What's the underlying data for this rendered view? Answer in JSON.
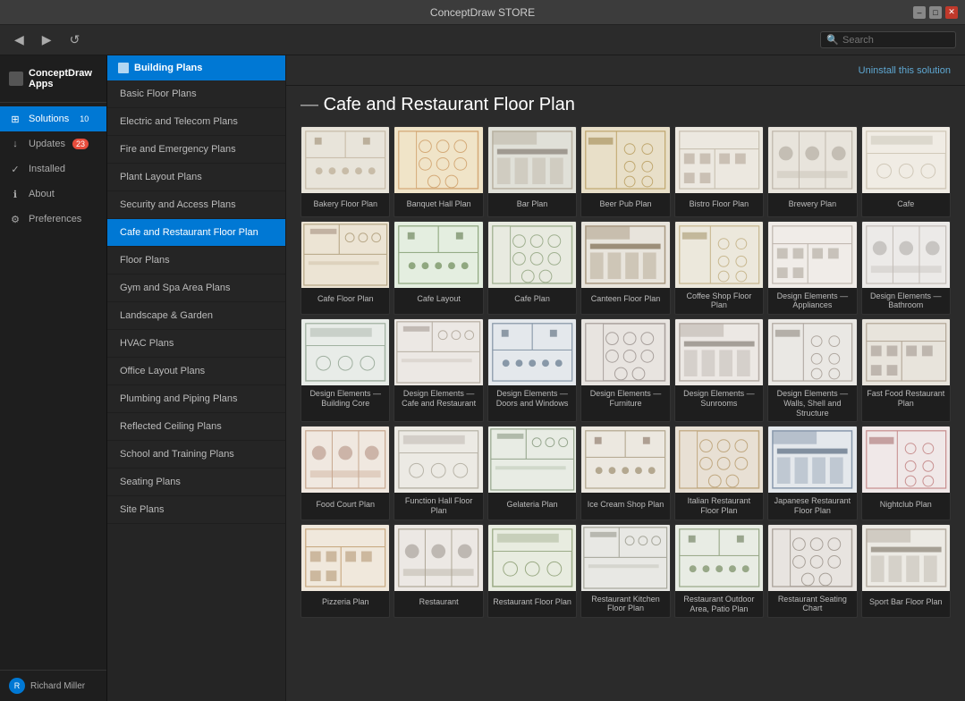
{
  "titlebar": {
    "title": "ConceptDraw STORE"
  },
  "toolbar": {
    "back_label": "◀",
    "forward_label": "▶",
    "refresh_label": "↺",
    "search_placeholder": "Search"
  },
  "sidebar": {
    "app_title": "ConceptDraw Apps",
    "items": [
      {
        "id": "solutions",
        "label": "Solutions",
        "badge": "10",
        "badge_color": "blue",
        "active": true
      },
      {
        "id": "updates",
        "label": "Updates",
        "badge": "23",
        "badge_color": "red",
        "active": false
      },
      {
        "id": "installed",
        "label": "Installed",
        "badge": "",
        "active": false
      },
      {
        "id": "about",
        "label": "About",
        "badge": "",
        "active": false
      },
      {
        "id": "preferences",
        "label": "Preferences",
        "badge": "",
        "active": false
      }
    ],
    "user": {
      "name": "Richard Miller",
      "avatar_initials": "R"
    }
  },
  "secondary_sidebar": {
    "header": "Building Plans",
    "items": [
      {
        "id": "basic",
        "label": "Basic Floor Plans",
        "active": false
      },
      {
        "id": "electric",
        "label": "Electric and Telecom Plans",
        "active": false
      },
      {
        "id": "fire",
        "label": "Fire and Emergency Plans",
        "active": false
      },
      {
        "id": "plant",
        "label": "Plant Layout Plans",
        "active": false
      },
      {
        "id": "security",
        "label": "Security and Access Plans",
        "active": false
      },
      {
        "id": "cafe",
        "label": "Cafe and Restaurant Floor Plan",
        "active": true
      },
      {
        "id": "floor",
        "label": "Floor Plans",
        "active": false
      },
      {
        "id": "gym",
        "label": "Gym and Spa Area Plans",
        "active": false
      },
      {
        "id": "landscape",
        "label": "Landscape & Garden",
        "active": false
      },
      {
        "id": "hvac",
        "label": "HVAC Plans",
        "active": false
      },
      {
        "id": "office",
        "label": "Office Layout Plans",
        "active": false
      },
      {
        "id": "plumbing",
        "label": "Plumbing and Piping Plans",
        "active": false
      },
      {
        "id": "reflected",
        "label": "Reflected Ceiling Plans",
        "active": false
      },
      {
        "id": "school",
        "label": "School and Training Plans",
        "active": false
      },
      {
        "id": "seating",
        "label": "Seating Plans",
        "active": false
      },
      {
        "id": "site",
        "label": "Site Plans",
        "active": false
      }
    ]
  },
  "main": {
    "page_title": "Cafe and Restaurant Floor Plan",
    "uninstall_label": "Uninstall this solution",
    "grid_items": [
      {
        "id": "bakery",
        "label": "Bakery Floor Plan",
        "bg": "#eceae2",
        "accent": "#b8aa90"
      },
      {
        "id": "banquet",
        "label": "Banquet Hall Plan",
        "bg": "#f0e4cc",
        "accent": "#c8a070"
      },
      {
        "id": "bar",
        "label": "Bar Plan",
        "bg": "#e4e2da",
        "accent": "#a09888"
      },
      {
        "id": "beerpub",
        "label": "Beer Pub Plan",
        "bg": "#e8dfc8",
        "accent": "#c0a878"
      },
      {
        "id": "bistro",
        "label": "Bistro Floor Plan",
        "bg": "#ece8e0",
        "accent": "#c8c0b0"
      },
      {
        "id": "brewery",
        "label": "Brewery Plan",
        "bg": "#e8e4dc",
        "accent": "#c0b8ac"
      },
      {
        "id": "cafe1",
        "label": "Cafe",
        "bg": "#f0ece4",
        "accent": "#d0c8b8"
      },
      {
        "id": "cafefloor",
        "label": "Cafe Floor Plan",
        "bg": "#ece4d4",
        "accent": "#b8a888"
      },
      {
        "id": "cafelayout",
        "label": "Cafe Layout",
        "bg": "#e8eee4",
        "accent": "#90a880"
      },
      {
        "id": "cafeplan",
        "label": "Cafe Plan",
        "bg": "#e4e8e0",
        "accent": "#a0b090"
      },
      {
        "id": "canteen",
        "label": "Canteen Floor Plan",
        "bg": "#e8e4dc",
        "accent": "#a89880"
      },
      {
        "id": "coffee",
        "label": "Coffee Shop Floor Plan",
        "bg": "#ece8dc",
        "accent": "#c8b890"
      },
      {
        "id": "designappliances",
        "label": "Design Elements — Appliances",
        "bg": "#f0ece8",
        "accent": "#c0b8b0"
      },
      {
        "id": "designbathroom",
        "label": "Design Elements — Bathroom",
        "bg": "#eceae8",
        "accent": "#c4beb8"
      },
      {
        "id": "designbuilding",
        "label": "Design Elements — Building Core",
        "bg": "#e8ece8",
        "accent": "#a0b0a0"
      },
      {
        "id": "designcafe",
        "label": "Design Elements — Cafe and Restaurant",
        "bg": "#ece8e4",
        "accent": "#b8b0a4"
      },
      {
        "id": "designdoors",
        "label": "Design Elements — Doors and Windows",
        "bg": "#e4e8ec",
        "accent": "#8898a8"
      },
      {
        "id": "designfurniture",
        "label": "Design Elements — Furniture",
        "bg": "#e8e4e0",
        "accent": "#a8a09c"
      },
      {
        "id": "designsunrooms",
        "label": "Design Elements — Sunrooms",
        "bg": "#ece8e4",
        "accent": "#b4aca4"
      },
      {
        "id": "designwalls",
        "label": "Design Elements — Walls, Shell and Structure",
        "bg": "#eae8e4",
        "accent": "#b0a8a0"
      },
      {
        "id": "fastfood",
        "label": "Fast Food Restaurant Plan",
        "bg": "#e8e4dc",
        "accent": "#b4a898"
      },
      {
        "id": "foodcourt",
        "label": "Food Court Plan",
        "bg": "#f0e8e0",
        "accent": "#c8a890"
      },
      {
        "id": "functionhall",
        "label": "Function Hall Floor Plan",
        "bg": "#eceae4",
        "accent": "#b8b4a8"
      },
      {
        "id": "gelateria",
        "label": "Gelateria Plan",
        "bg": "#e8ece4",
        "accent": "#98a890"
      },
      {
        "id": "icecream",
        "label": "Ice Cream Shop Plan",
        "bg": "#ece8e0",
        "accent": "#b4a890"
      },
      {
        "id": "italian",
        "label": "Italian Restaurant Floor Plan",
        "bg": "#e8e0d4",
        "accent": "#c0a880"
      },
      {
        "id": "japanese",
        "label": "Japanese Restaurant Floor Plan",
        "bg": "#e4e8ec",
        "accent": "#8898ac"
      },
      {
        "id": "nightclub",
        "label": "Nightclub Plan",
        "bg": "#f0e8e8",
        "accent": "#c89090"
      },
      {
        "id": "pizzeria",
        "label": "Pizzeria Plan",
        "bg": "#f0e8dc",
        "accent": "#c8a880"
      },
      {
        "id": "restaurant",
        "label": "Restaurant",
        "bg": "#ece8e4",
        "accent": "#b0a898"
      },
      {
        "id": "restaurantfloor",
        "label": "Restaurant Floor Plan",
        "bg": "#e8ece0",
        "accent": "#9aaa84"
      },
      {
        "id": "restaurantkitchen",
        "label": "Restaurant Kitchen Floor Plan",
        "bg": "#e8e8e4",
        "accent": "#a8a89c"
      },
      {
        "id": "restaurantoutdoor",
        "label": "Restaurant Outdoor Area, Patio Plan",
        "bg": "#e8ece4",
        "accent": "#98a888"
      },
      {
        "id": "restaurantseating",
        "label": "Restaurant Seating Chart",
        "bg": "#e8e4e0",
        "accent": "#a8a098"
      },
      {
        "id": "sportbar",
        "label": "Sport Bar Floor Plan",
        "bg": "#eceae4",
        "accent": "#b4aca0"
      }
    ]
  }
}
